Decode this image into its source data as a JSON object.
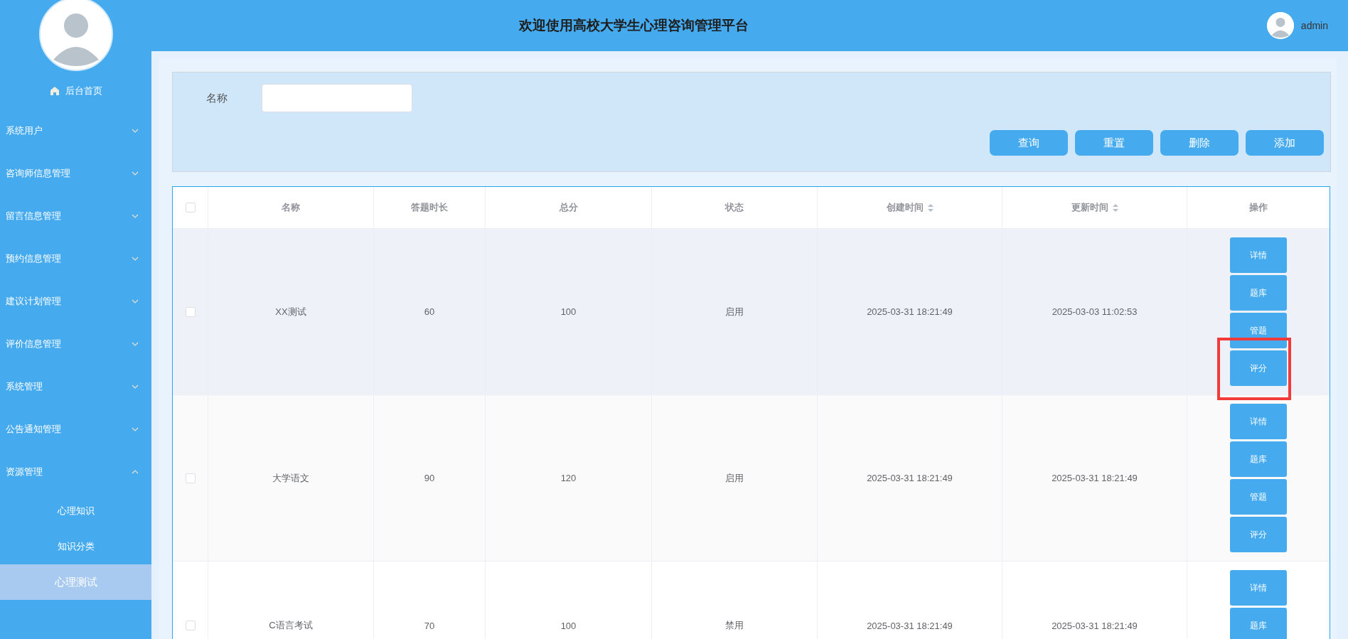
{
  "sidebar": {
    "home": "后台首页",
    "items": [
      {
        "label": "系统用户",
        "expanded": false
      },
      {
        "label": "咨询师信息管理",
        "expanded": false
      },
      {
        "label": "留言信息管理",
        "expanded": false
      },
      {
        "label": "预约信息管理",
        "expanded": false
      },
      {
        "label": "建议计划管理",
        "expanded": false
      },
      {
        "label": "评价信息管理",
        "expanded": false
      },
      {
        "label": "系统管理",
        "expanded": false
      },
      {
        "label": "公告通知管理",
        "expanded": false
      },
      {
        "label": "资源管理",
        "expanded": true,
        "children": [
          {
            "label": "心理知识",
            "selected": false
          },
          {
            "label": "知识分类",
            "selected": false
          },
          {
            "label": "心理测试",
            "selected": true
          }
        ]
      }
    ]
  },
  "header": {
    "title": "欢迎使用高校大学生心理咨询管理平台",
    "user": "admin"
  },
  "search": {
    "label": "名称",
    "buttons": [
      "查询",
      "重置",
      "删除",
      "添加"
    ]
  },
  "table": {
    "select_all": {
      "checked": false
    },
    "columns": [
      {
        "label": "名称",
        "sortable": false
      },
      {
        "label": "答题时长",
        "sortable": false
      },
      {
        "label": "总分",
        "sortable": false
      },
      {
        "label": "状态",
        "sortable": false
      },
      {
        "label": "创建时间",
        "sortable": true
      },
      {
        "label": "更新时间",
        "sortable": true
      },
      {
        "label": "操作",
        "sortable": false
      }
    ],
    "rows": [
      {
        "checked": false,
        "hovered": true,
        "cells": [
          "XX测试",
          "60",
          "100",
          "启用",
          "2025-03-31 18:21:49",
          "2025-03-03 11:02:53"
        ],
        "actions": [
          {
            "label": "详情",
            "annotated": false
          },
          {
            "label": "题库",
            "annotated": false
          },
          {
            "label": "管题",
            "annotated": false
          },
          {
            "label": "评分",
            "annotated": true
          }
        ]
      },
      {
        "checked": false,
        "hovered": false,
        "cells": [
          "大学语文",
          "90",
          "120",
          "启用",
          "2025-03-31 18:21:49",
          "2025-03-31 18:21:49"
        ],
        "actions": [
          {
            "label": "详情",
            "annotated": false
          },
          {
            "label": "题库",
            "annotated": false
          },
          {
            "label": "管题",
            "annotated": false
          },
          {
            "label": "评分",
            "annotated": false
          }
        ]
      },
      {
        "checked": false,
        "hovered": false,
        "cells": [
          "C语言考试",
          "70",
          "100",
          "禁用",
          "2025-03-31 18:21:49",
          "2025-03-31 18:21:49"
        ],
        "actions": [
          {
            "label": "详情",
            "annotated": false
          },
          {
            "label": "题库",
            "annotated": false
          }
        ]
      }
    ]
  }
}
